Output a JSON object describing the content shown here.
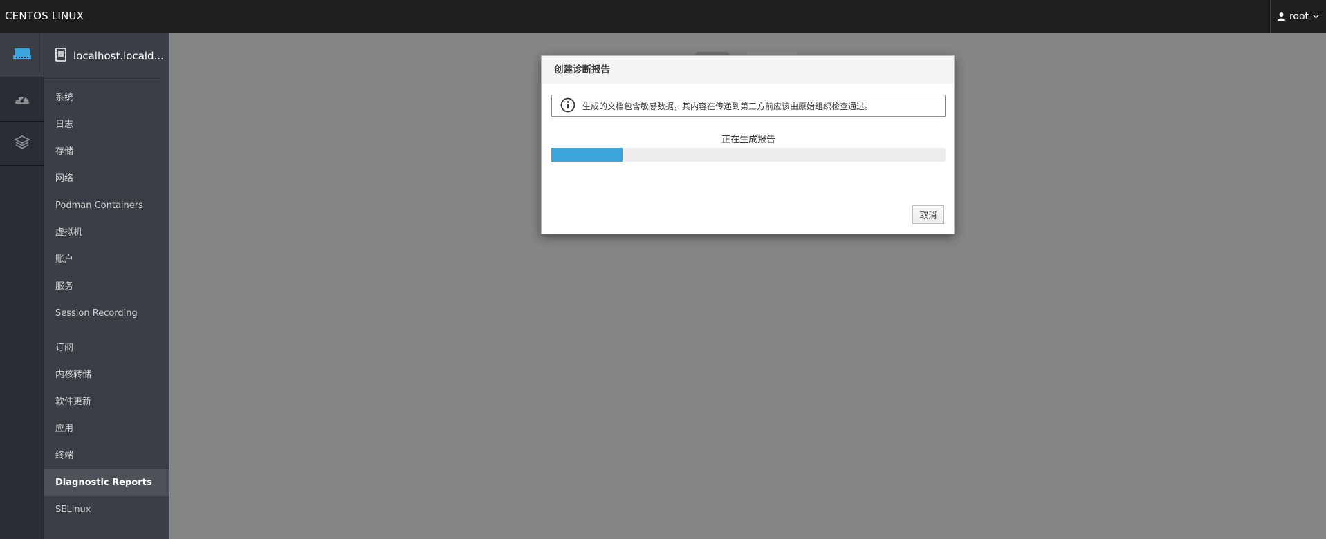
{
  "topbar": {
    "brand": "CENTOS LINUX",
    "user": "root"
  },
  "rail": {
    "items": [
      {
        "icon": "server-icon",
        "active": true
      },
      {
        "icon": "dashboard-icon",
        "active": false
      },
      {
        "icon": "layers-icon",
        "active": false
      }
    ]
  },
  "nav": {
    "host": "localhost.locald...",
    "items": [
      "系统",
      "日志",
      "存储",
      "网络",
      "Podman Containers",
      "虚拟机",
      "账户",
      "服务",
      "Session Recording"
    ],
    "items2": [
      "订阅",
      "内核转储",
      "软件更新",
      "应用",
      "终端",
      "Diagnostic Reports",
      "SELinux"
    ],
    "active": "Diagnostic Reports"
  },
  "modal": {
    "title": "创建诊断报告",
    "alert": "生成的文档包含敏感数据，其内容在传递到第三方前应该由原始组织检查通过。",
    "status": "正在生成报告",
    "progress": 0.18,
    "cancel_label": "取消"
  },
  "colors": {
    "accent": "#39a5dc",
    "rail_icon_active": "#39a5dc"
  }
}
